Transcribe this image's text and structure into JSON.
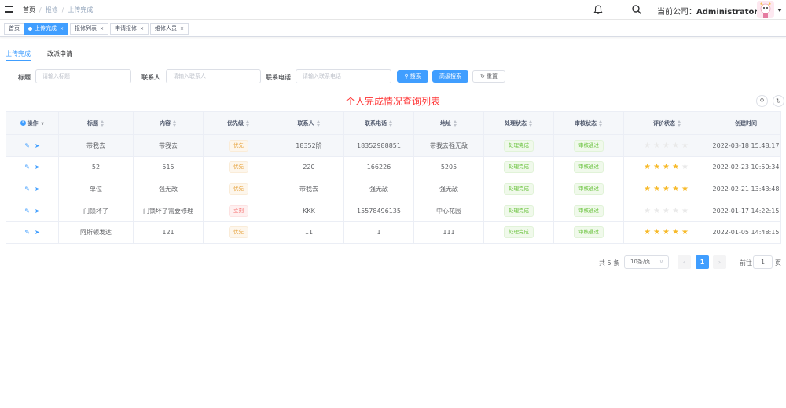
{
  "navbar": {
    "breadcrumb": [
      "首页",
      "报修",
      "上传完成"
    ],
    "company_label": "当前公司：",
    "company_name": "Administrator"
  },
  "tags": [
    {
      "label": "首页",
      "active": false,
      "closable": false
    },
    {
      "label": "上传完成",
      "active": true,
      "closable": true
    },
    {
      "label": "报修列表",
      "active": false,
      "closable": true
    },
    {
      "label": "申请报修",
      "active": false,
      "closable": true
    },
    {
      "label": "维修人员",
      "active": false,
      "closable": true
    }
  ],
  "tabs": [
    "上传完成",
    "改派申请"
  ],
  "search": {
    "title_label": "标题",
    "title_placeholder": "请输入标题",
    "contact_label": "联系人",
    "contact_placeholder": "请输入联系人",
    "phone_label": "联系电话",
    "phone_placeholder": "请输入联系电话",
    "search_btn": "搜索",
    "advanced_btn": "高级搜索",
    "reset_btn": "重置"
  },
  "list_title": "个人完成情况查询列表",
  "table": {
    "columns": [
      "操作",
      "标题",
      "内容",
      "优先级",
      "联系人",
      "联系电话",
      "地址",
      "处理状态",
      "审核状态",
      "评价状态",
      "创建时间"
    ],
    "rows": [
      {
        "title": "带我去",
        "content": "带我去",
        "priority": "优先",
        "priority_type": "warn",
        "contact": "18352阶",
        "phone": "18352988851",
        "address": "带我去强无敌",
        "process": "处理完成",
        "audit": "审核通过",
        "rating": 0,
        "created": "2022-03-18 15:48:17"
      },
      {
        "title": "52",
        "content": "515",
        "priority": "优先",
        "priority_type": "warn",
        "contact": "220",
        "phone": "166226",
        "address": "5205",
        "process": "处理完成",
        "audit": "审核通过",
        "rating": 4,
        "created": "2022-02-23 10:50:34"
      },
      {
        "title": "单位",
        "content": "强无敌",
        "priority": "优先",
        "priority_type": "warn",
        "contact": "带我去",
        "phone": "强无敌",
        "address": "强无敌",
        "process": "处理完成",
        "audit": "审核通过",
        "rating": 5,
        "created": "2022-02-21 13:43:48"
      },
      {
        "title": "门锁坏了",
        "content": "门锁坏了需要修理",
        "priority": "立刻",
        "priority_type": "danger",
        "contact": "KKK",
        "phone": "15578496135",
        "address": "中心花园",
        "process": "处理完成",
        "audit": "审核通过",
        "rating": 0,
        "created": "2022-01-17 14:22:15"
      },
      {
        "title": "阿斯顿发达",
        "content": "121",
        "priority": "优先",
        "priority_type": "warn",
        "contact": "11",
        "phone": "1",
        "address": "111",
        "process": "处理完成",
        "audit": "审核通过",
        "rating": 5,
        "created": "2022-01-05 14:48:15"
      }
    ]
  },
  "pagination": {
    "total": "共 5 条",
    "page_size": "10条/页",
    "current": "1",
    "goto_label": "前往",
    "goto_value": "1",
    "page_label": "页"
  },
  "colors": {
    "primary": "#409eff",
    "star": "#f7ba2a",
    "title_red": "#ff3333"
  }
}
